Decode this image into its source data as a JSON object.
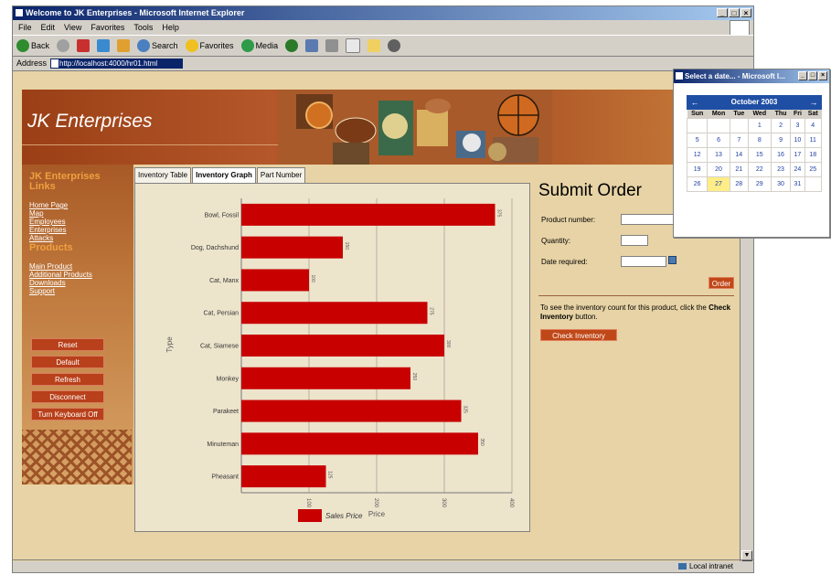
{
  "window": {
    "title": "Welcome to JK Enterprises - Microsoft Internet Explorer",
    "menu": [
      "File",
      "Edit",
      "View",
      "Favorites",
      "Tools",
      "Help"
    ],
    "toolbar": {
      "back": "Back",
      "search": "Search",
      "favorites": "Favorites",
      "media": "Media"
    },
    "address_label": "Address",
    "address_value": "http://localhost:4000/hr01.html",
    "status_zone": "Local intranet"
  },
  "site": {
    "logo": "JK Enterprises",
    "links_heading": "JK Enterprises Links",
    "links": [
      "Home Page",
      "Map",
      "Employees",
      "Enterprises",
      "Attacks"
    ],
    "products_heading": "Products",
    "product_links": [
      "Main Product",
      "Additional Products",
      "Downloads",
      "Support"
    ],
    "buttons": [
      "Reset",
      "Default",
      "Refresh",
      "Disconnect",
      "Turn Keyboard Off"
    ]
  },
  "tabs": [
    "Inventory Table",
    "Inventory Graph",
    "Part Number"
  ],
  "chart_data": {
    "type": "bar",
    "orientation": "horizontal",
    "categories": [
      "Bowl, Fossil",
      "Dog, Dachshund",
      "Cat, Manx",
      "Cat, Persian",
      "Cat, Siamese",
      "Monkey",
      "Parakeet",
      "Minuteman",
      "Pheasant"
    ],
    "series": [
      {
        "name": "Sales Price",
        "values": [
          375,
          150,
          100,
          275,
          300,
          250,
          325,
          350,
          125
        ]
      }
    ],
    "value_labels": [
      "375",
      "150",
      "100",
      "275",
      "300",
      "250",
      "325",
      "350",
      "125"
    ],
    "xlabel": "Price",
    "ylabel": "Type",
    "xticks": [
      "",
      "100",
      "200",
      "300",
      "400"
    ],
    "xlim": [
      0,
      400
    ],
    "grid": true,
    "legend": "bottom",
    "color": "#c80000"
  },
  "order": {
    "title": "Submit Order",
    "product_label": "Product number:",
    "quantity_label": "Quantity:",
    "date_label": "Date required:",
    "order_button": "Order",
    "note_prefix": "To see the inventory count for this product, click the ",
    "note_bold": "Check Inventory",
    "note_suffix": " button.",
    "check_button": "Check Inventory"
  },
  "calendar": {
    "title": "Select a date... - Microsoft I...",
    "month": "October 2003",
    "prev": "←",
    "next": "→",
    "days": [
      "Sun",
      "Mon",
      "Tue",
      "Wed",
      "Thu",
      "Fri",
      "Sat"
    ],
    "weeks": [
      [
        "",
        "",
        "",
        "1",
        "2",
        "3",
        "4"
      ],
      [
        "5",
        "6",
        "7",
        "8",
        "9",
        "10",
        "11"
      ],
      [
        "12",
        "13",
        "14",
        "15",
        "16",
        "17",
        "18"
      ],
      [
        "19",
        "20",
        "21",
        "22",
        "23",
        "24",
        "25"
      ],
      [
        "26",
        "27",
        "28",
        "29",
        "30",
        "31",
        ""
      ]
    ],
    "today": "27"
  }
}
